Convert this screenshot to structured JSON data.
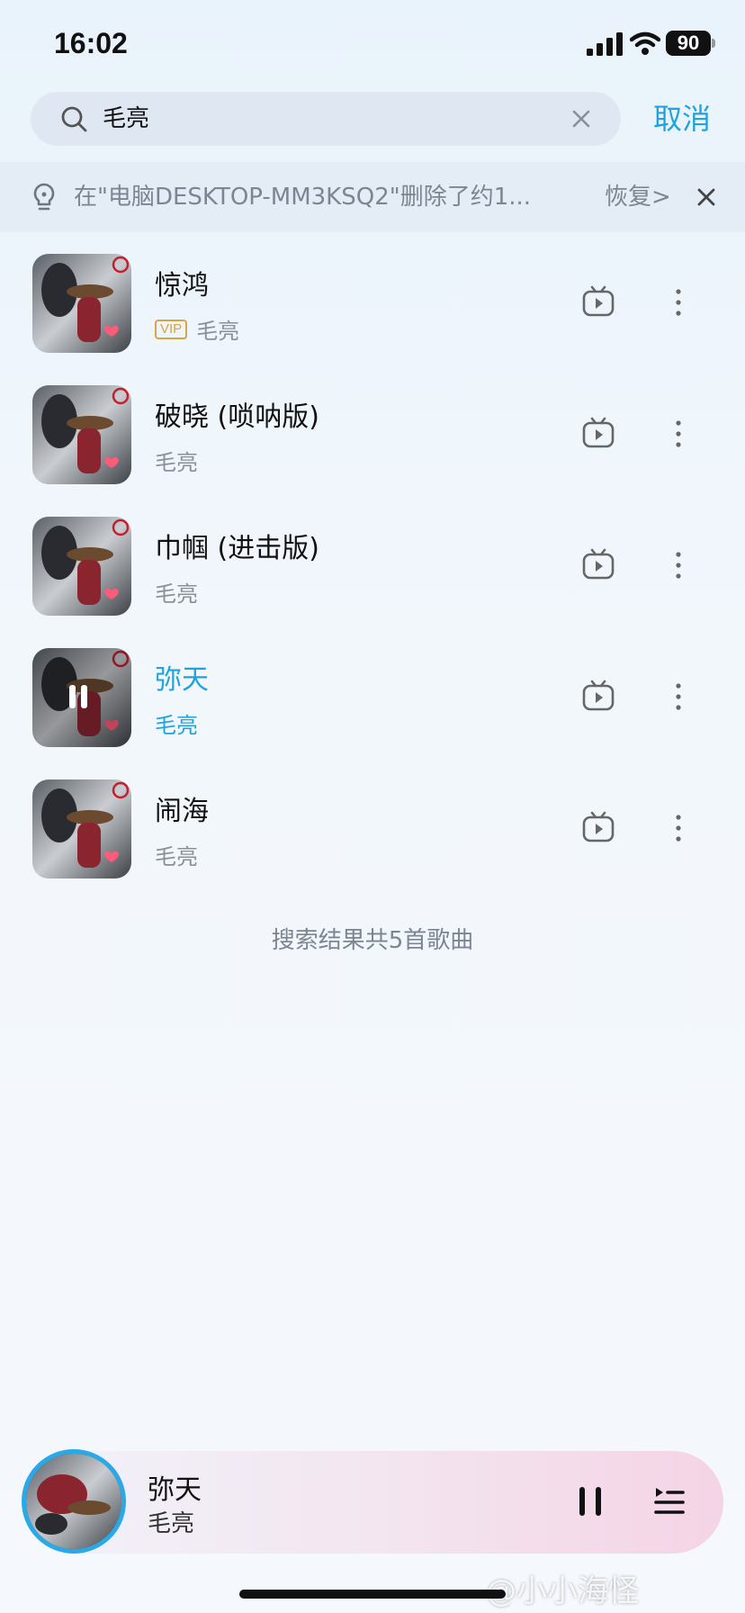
{
  "status_bar": {
    "time": "16:02",
    "battery": "90"
  },
  "search": {
    "query": "毛亮",
    "cancel_label": "取消"
  },
  "notice": {
    "text": "在\"电脑DESKTOP-MM3KSQ2\"删除了约1...",
    "restore_label": "恢复>"
  },
  "songs": [
    {
      "title": "惊鸿",
      "artist": "毛亮",
      "vip": "VIP"
    },
    {
      "title": "破晓 (唢呐版)",
      "artist": "毛亮"
    },
    {
      "title": "巾帼 (进击版)",
      "artist": "毛亮"
    },
    {
      "title": "弥天",
      "artist": "毛亮"
    },
    {
      "title": "闹海",
      "artist": "毛亮"
    }
  ],
  "result_count": "搜索结果共5首歌曲",
  "player": {
    "title": "弥天",
    "artist": "毛亮"
  },
  "watermark": "@小小海怪",
  "colors": {
    "accent": "#1fa3e0",
    "favorite": "#ff5a7a",
    "vip": "#d9a441"
  }
}
